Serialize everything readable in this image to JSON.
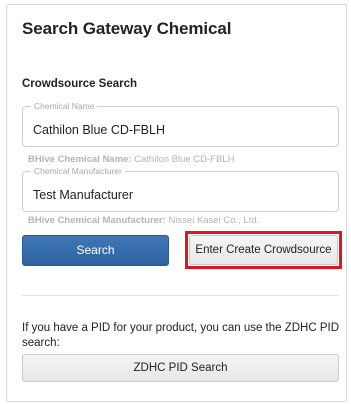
{
  "page": {
    "title": "Search Gateway Chemical"
  },
  "crowdsource": {
    "section_title": "Crowdsource Search",
    "chemical_name": {
      "label": "Chemical Name",
      "value": "Cathilon Blue CD-FBLH",
      "hint_label": "BHive Chemical Name:",
      "hint_value": "Cathilon Blue CD-FBLH"
    },
    "chemical_manufacturer": {
      "label": "Chemical Manufacturer",
      "value": "Test Manufacturer",
      "hint_label": "BHive Chemical Manufacturer:",
      "hint_value": "Nissei Kasei Co., Ltd."
    },
    "search_button": "Search",
    "create_button": "Enter Create Crowdsource"
  },
  "pid": {
    "description": "If you have a PID for your product, you can use the ZDHC PID search:",
    "button": "ZDHC PID Search"
  },
  "colors": {
    "primary": "#2e63a1",
    "highlight": "#e0161e"
  }
}
